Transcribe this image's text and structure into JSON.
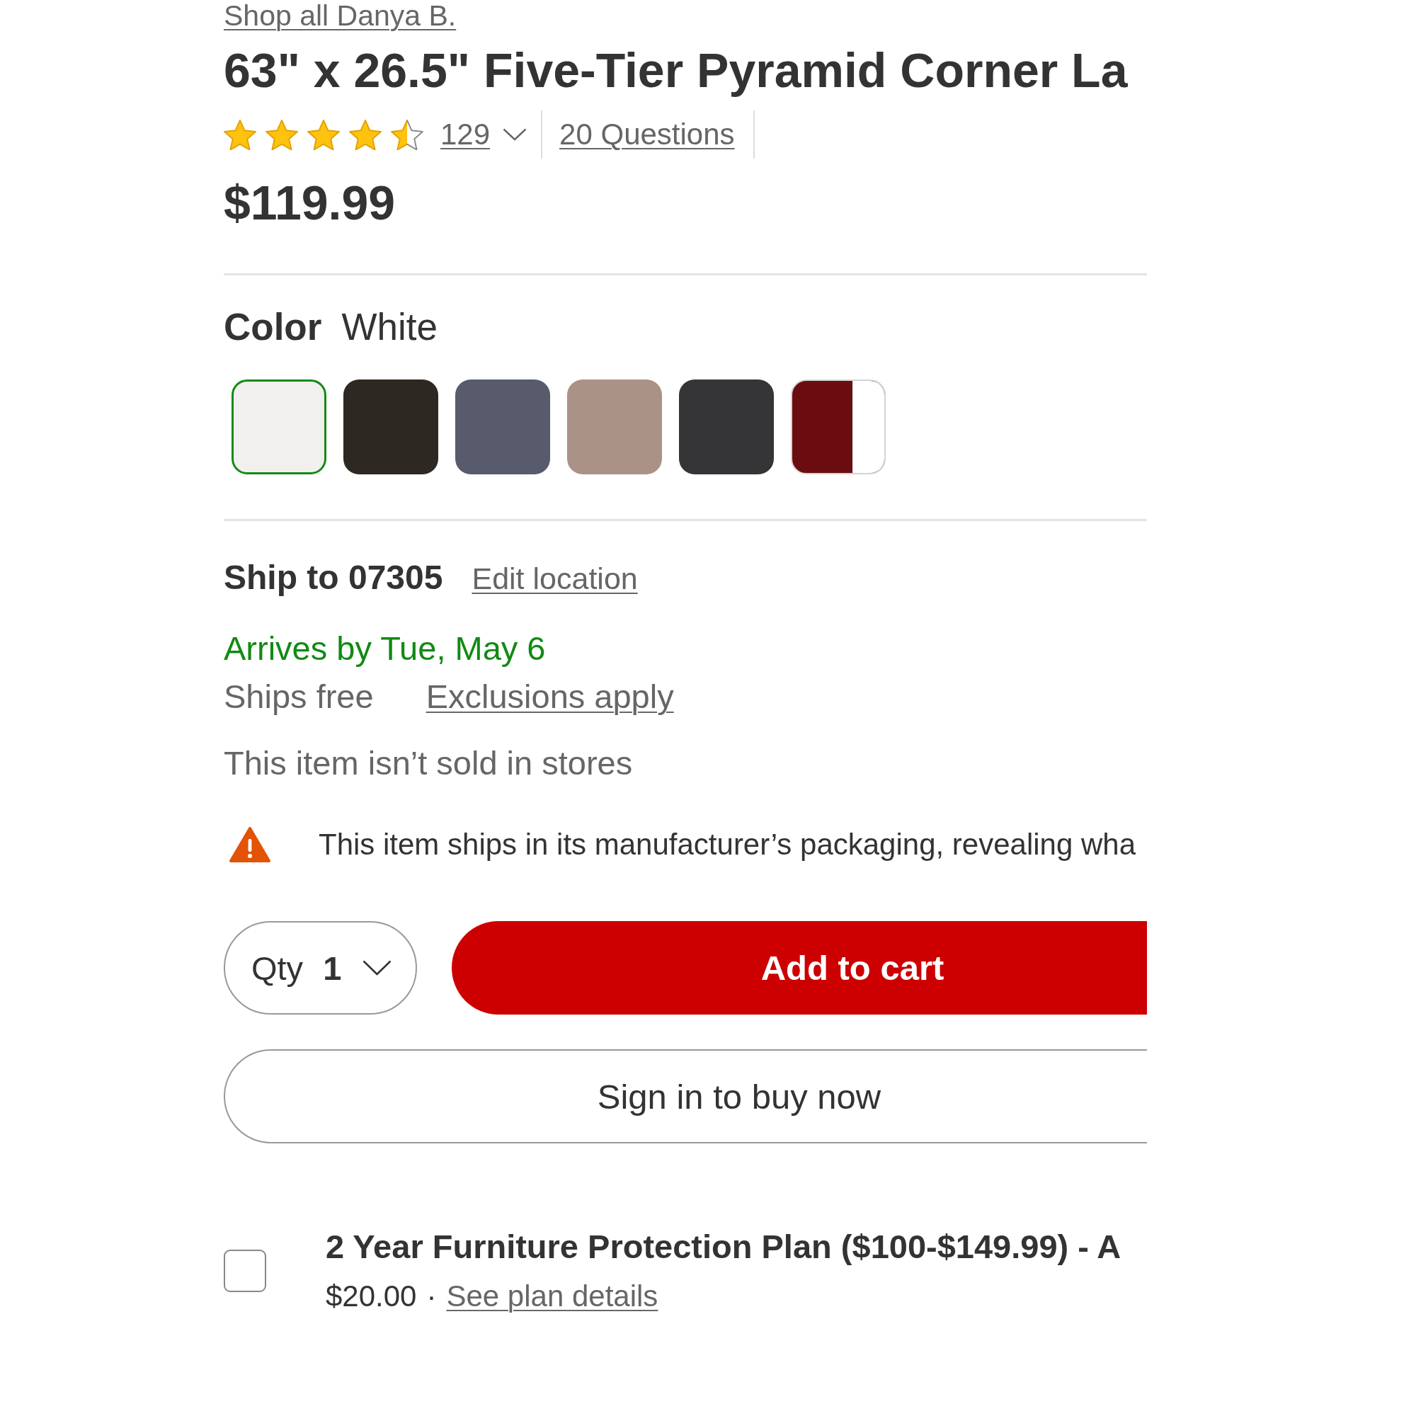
{
  "brand_link": "Shop all Danya B.",
  "title": "63\" x 26.5\" Five-Tier Pyramid Corner La",
  "rating": {
    "stars": 4.5,
    "review_count": "129",
    "questions_link": "20 Questions"
  },
  "price": "$119.99",
  "color_picker": {
    "label": "Color",
    "value": "White",
    "swatches": [
      {
        "kind": "solid",
        "color": "#f1f0ee",
        "selected": true
      },
      {
        "kind": "solid",
        "color": "#2e2823",
        "selected": false
      },
      {
        "kind": "solid",
        "color": "#585b6b",
        "selected": false
      },
      {
        "kind": "solid",
        "color": "#ab9286",
        "selected": false
      },
      {
        "kind": "solid",
        "color": "#353537",
        "selected": false
      },
      {
        "kind": "split",
        "color": "#6b0d10",
        "selected": false
      }
    ]
  },
  "shipping": {
    "heading": "Ship to 07305",
    "edit_link": "Edit location",
    "arrival": "Arrives by Tue, May 6",
    "cost": "Ships free",
    "exclusions_link": "Exclusions apply",
    "store_note": "This item isn’t sold in stores"
  },
  "notice": {
    "kind": "warning",
    "text": "This item ships in its manufacturer’s packaging, revealing wha"
  },
  "purchase": {
    "qty_label": "Qty",
    "qty_value": "1",
    "add_to_cart": "Add to cart",
    "buy_now": "Sign in to buy now"
  },
  "protection_plan": {
    "checked": false,
    "title": "2 Year Furniture Protection Plan ($100-$149.99) - A",
    "price": "$20.00",
    "separator": "·",
    "details_link": "See plan details"
  }
}
